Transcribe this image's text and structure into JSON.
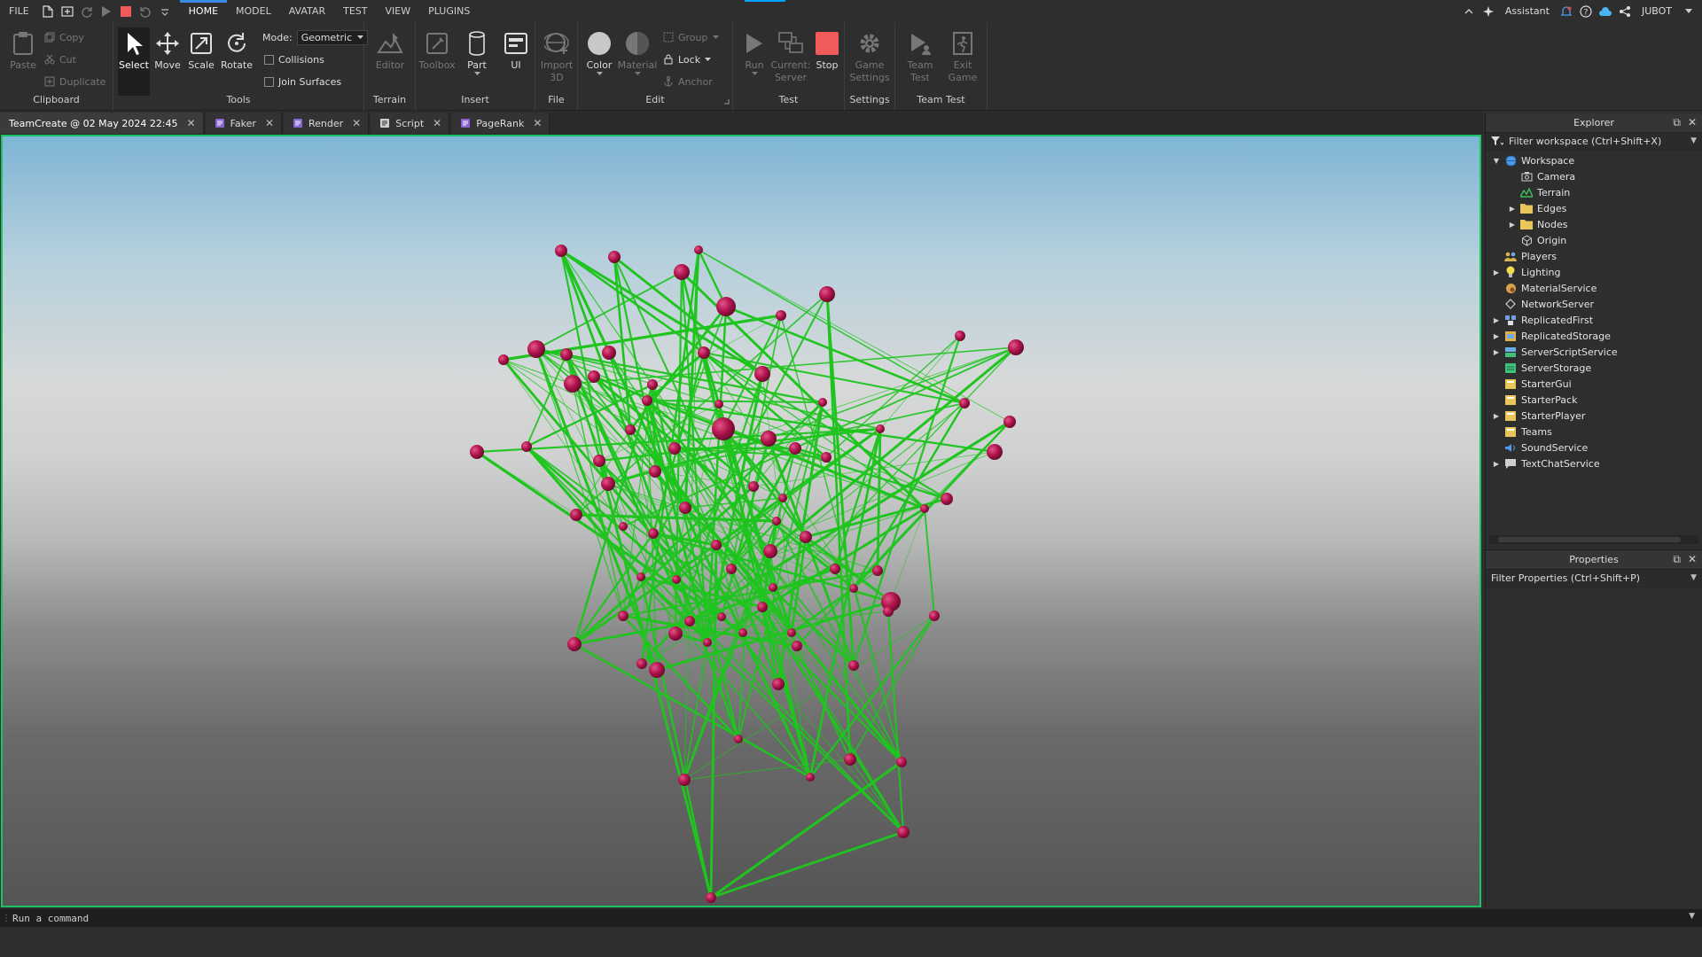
{
  "menubar": {
    "file": "FILE",
    "tabs": [
      "HOME",
      "MODEL",
      "AVATAR",
      "TEST",
      "VIEW",
      "PLUGINS"
    ],
    "active_tab": "HOME",
    "assistant": "Assistant",
    "user": "JUBOT"
  },
  "ribbon": {
    "clipboard": {
      "label": "Clipboard",
      "paste": "Paste",
      "copy": "Copy",
      "cut": "Cut",
      "duplicate": "Duplicate"
    },
    "tools": {
      "label": "Tools",
      "select": "Select",
      "move": "Move",
      "scale": "Scale",
      "rotate": "Rotate",
      "mode_label": "Mode:",
      "mode_value": "Geometric",
      "collisions": "Collisions",
      "join_surfaces": "Join Surfaces"
    },
    "terrain": {
      "label": "Terrain",
      "editor": "Editor"
    },
    "insert": {
      "label": "Insert",
      "toolbox": "Toolbox",
      "part": "Part",
      "ui": "UI"
    },
    "file": {
      "label": "File",
      "import": "Import",
      "import2": "3D"
    },
    "edit": {
      "label": "Edit",
      "color": "Color",
      "material": "Material",
      "group": "Group",
      "lock": "Lock",
      "anchor": "Anchor"
    },
    "test": {
      "label": "Test",
      "run": "Run",
      "current": "Current:",
      "server": "Server",
      "stop": "Stop"
    },
    "settings": {
      "label": "Settings",
      "game": "Game",
      "settings": "Settings"
    },
    "team_test": {
      "label": "Team Test",
      "team": "Team",
      "test": "Test",
      "exit": "Exit",
      "game": "Game"
    }
  },
  "doc_tabs": [
    {
      "label": "TeamCreate @ 02 May 2024 22:45",
      "icon": "none"
    },
    {
      "label": "Faker",
      "icon": "script-icon"
    },
    {
      "label": "Render",
      "icon": "script-icon"
    },
    {
      "label": "Script",
      "icon": "script-icon"
    },
    {
      "label": "PageRank",
      "icon": "script-icon"
    }
  ],
  "explorer": {
    "title": "Explorer",
    "filter": "Filter workspace (Ctrl+Shift+X)",
    "items": [
      {
        "label": "Workspace",
        "depth": 0,
        "expand": "open",
        "icon": "globe",
        "color": "#4c9be8"
      },
      {
        "label": "Camera",
        "depth": 1,
        "expand": "none",
        "icon": "camera",
        "color": "#cfcfcf"
      },
      {
        "label": "Terrain",
        "depth": 1,
        "expand": "none",
        "icon": "terrain",
        "color": "#3fbf5a"
      },
      {
        "label": "Edges",
        "depth": 1,
        "expand": "closed",
        "icon": "folder",
        "color": "#e9c65a"
      },
      {
        "label": "Nodes",
        "depth": 1,
        "expand": "closed",
        "icon": "folder",
        "color": "#e9c65a"
      },
      {
        "label": "Origin",
        "depth": 1,
        "expand": "none",
        "icon": "part",
        "color": "#cfcfcf"
      },
      {
        "label": "Players",
        "depth": 0,
        "expand": "none",
        "icon": "players",
        "color": "#d8b44a"
      },
      {
        "label": "Lighting",
        "depth": 0,
        "expand": "closed",
        "icon": "bulb",
        "color": "#f2d94e"
      },
      {
        "label": "MaterialService",
        "depth": 0,
        "expand": "none",
        "icon": "material",
        "color": "#d9a24a"
      },
      {
        "label": "NetworkServer",
        "depth": 0,
        "expand": "none",
        "icon": "diamond",
        "color": "#cfcfcf"
      },
      {
        "label": "ReplicatedFirst",
        "depth": 0,
        "expand": "closed",
        "icon": "replicated",
        "color": "#6f9fe0"
      },
      {
        "label": "ReplicatedStorage",
        "depth": 0,
        "expand": "closed",
        "icon": "storage",
        "color": "#e0b24a"
      },
      {
        "label": "ServerScriptService",
        "depth": 0,
        "expand": "closed",
        "icon": "server-script",
        "color": "#3fbf7a"
      },
      {
        "label": "ServerStorage",
        "depth": 0,
        "expand": "none",
        "icon": "server-storage",
        "color": "#3fbf7a"
      },
      {
        "label": "StarterGui",
        "depth": 0,
        "expand": "none",
        "icon": "starter",
        "color": "#e9c65a"
      },
      {
        "label": "StarterPack",
        "depth": 0,
        "expand": "none",
        "icon": "starter",
        "color": "#e9c65a"
      },
      {
        "label": "StarterPlayer",
        "depth": 0,
        "expand": "closed",
        "icon": "starter",
        "color": "#e9c65a"
      },
      {
        "label": "Teams",
        "depth": 0,
        "expand": "none",
        "icon": "starter",
        "color": "#e9c65a"
      },
      {
        "label": "SoundService",
        "depth": 0,
        "expand": "none",
        "icon": "sound",
        "color": "#4c9be8"
      },
      {
        "label": "TextChatService",
        "depth": 0,
        "expand": "closed",
        "icon": "chat",
        "color": "#cfcfcf"
      }
    ]
  },
  "properties": {
    "title": "Properties",
    "filter": "Filter Properties (Ctrl+Shift+P)"
  },
  "command_bar": {
    "placeholder": "Run a command"
  },
  "colors": {
    "accent": "#3d8be6",
    "viewport_border": "#19c463",
    "edge": "#1fc41f",
    "node": "#b5154f",
    "stop": "#f05a5a"
  }
}
